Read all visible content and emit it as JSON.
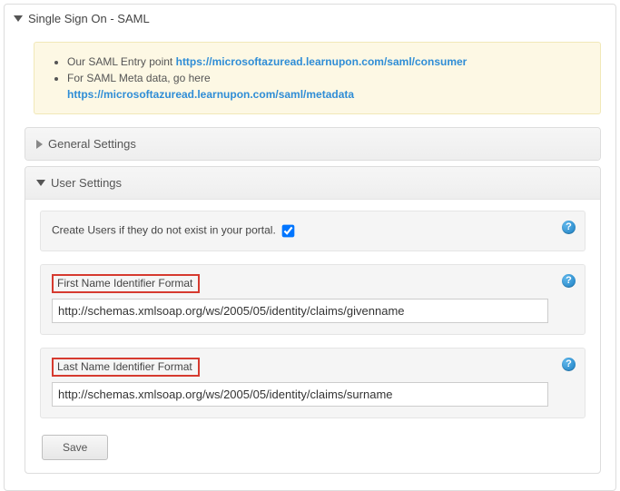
{
  "page": {
    "title": "Single Sign On - SAML"
  },
  "notice": {
    "line1_text": "Our SAML Entry point ",
    "line1_link": "https://microsoftazuread.learnupon.com/saml/consumer",
    "line2_text": "For SAML Meta data, go here ",
    "line2_link": "https://microsoftazuread.learnupon.com/saml/metadata"
  },
  "panels": {
    "general": {
      "title": "General Settings"
    },
    "user": {
      "title": "User Settings"
    }
  },
  "user_settings": {
    "create_users_label": "Create Users if they do not exist in your portal.",
    "first_name": {
      "label": "First Name Identifier Format",
      "value": "http://schemas.xmlsoap.org/ws/2005/05/identity/claims/givenname"
    },
    "last_name": {
      "label": "Last Name Identifier Format",
      "value": "http://schemas.xmlsoap.org/ws/2005/05/identity/claims/surname"
    },
    "save_label": "Save"
  }
}
